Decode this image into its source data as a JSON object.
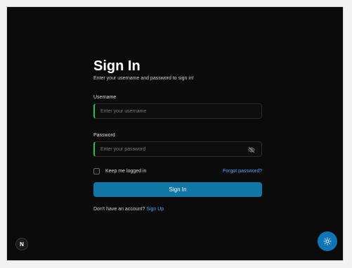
{
  "login": {
    "title": "Sign In",
    "subtitle": "Enter your username and password to sign in!",
    "username": {
      "label": "Username",
      "placeholder": "Enter your username"
    },
    "password": {
      "label": "Password",
      "placeholder": "Enter your password",
      "toggle_icon": "eye-off-icon"
    },
    "remember_label": "Keep me logged in",
    "forgot_label": "Forgot password?",
    "submit_label": "Sign In",
    "signup_prompt": "Don't have an account?",
    "signup_link": "Sign Up"
  },
  "badge_text": "N",
  "icons": {
    "theme_toggle": "sun-icon"
  },
  "colors": {
    "accent": "#1076a3",
    "link": "#4fa3ff",
    "focus": "#20c35a",
    "background": "#0b0b0b"
  }
}
